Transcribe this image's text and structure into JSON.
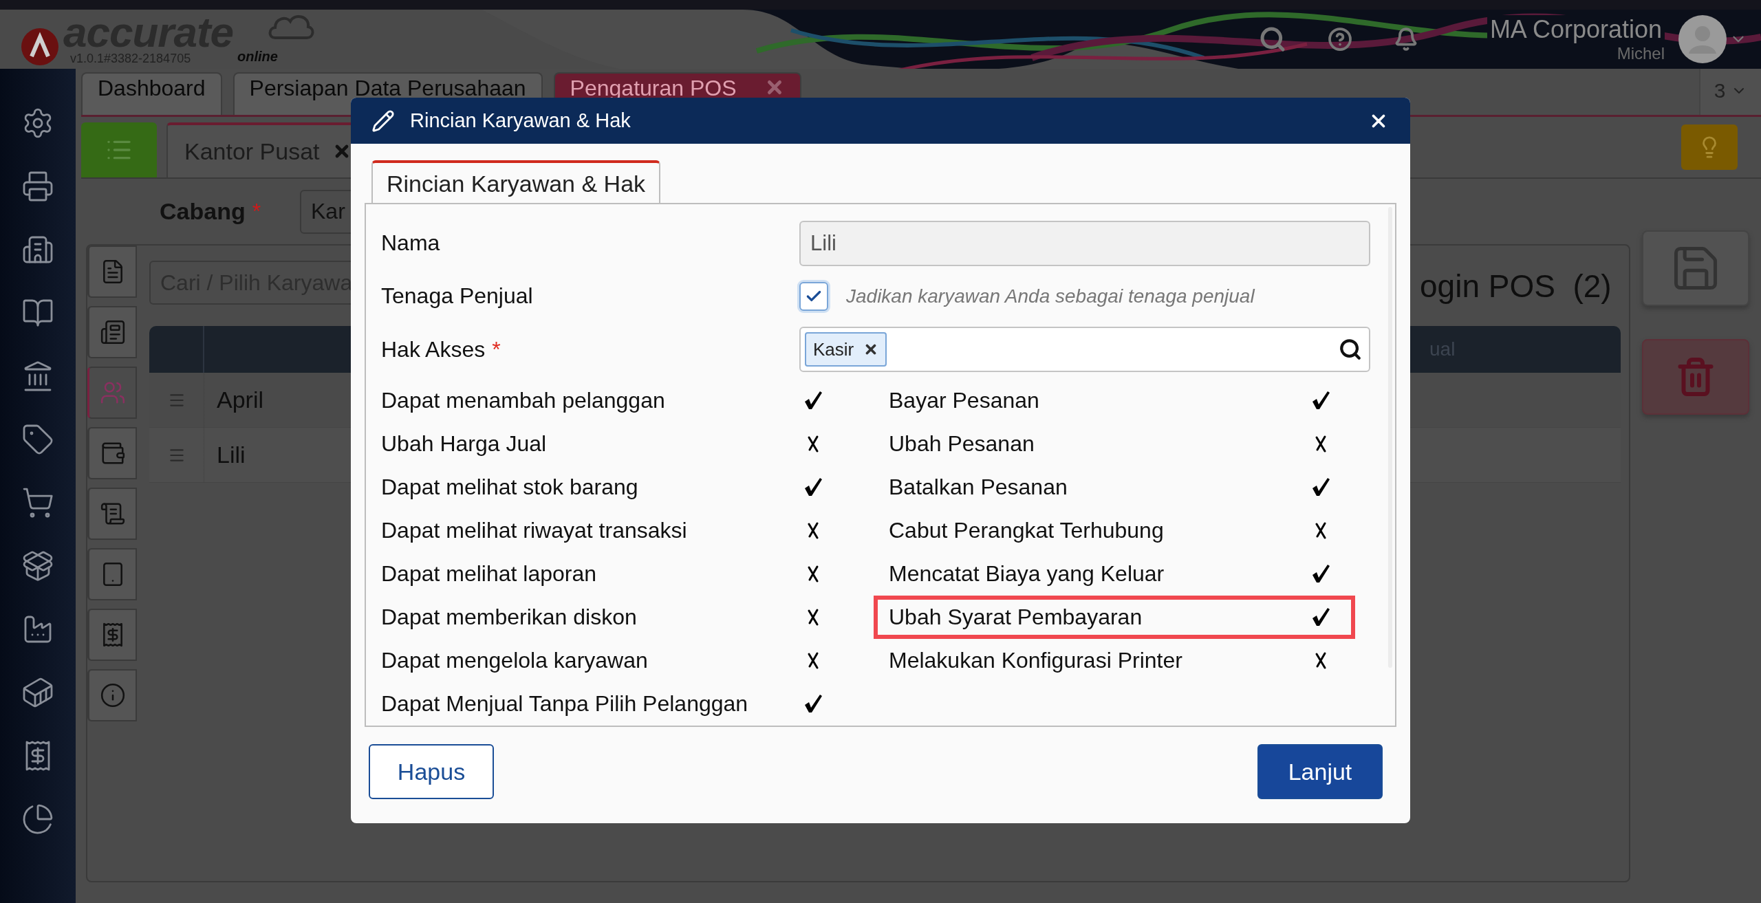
{
  "app": {
    "logo": "accurate",
    "logo_sub": "online",
    "version": "v1.0.1#3382-2184705",
    "company": "MA Corporation",
    "user": "Michel"
  },
  "tabs": [
    {
      "label": "Dashboard",
      "selected": false,
      "closable": false
    },
    {
      "label": "Persiapan Data Perusahaan",
      "selected": false,
      "closable": false
    },
    {
      "label": "Pengaturan POS",
      "selected": true,
      "closable": true
    }
  ],
  "tab_count": "3",
  "branch_tabs": [
    {
      "label": "Kantor Pusat",
      "selected": true,
      "closable": true
    }
  ],
  "branch": {
    "label": "Cabang",
    "required_mark": "*",
    "value": "Kar"
  },
  "side_tabs": [
    {
      "selected": false
    },
    {
      "selected": false
    },
    {
      "selected": true
    },
    {
      "selected": false
    },
    {
      "selected": false
    },
    {
      "selected": false
    },
    {
      "selected": false
    },
    {
      "selected": false
    }
  ],
  "employees": {
    "search_placeholder": "Cari / Pilih Karyawa",
    "rows": [
      "April",
      "Lili"
    ]
  },
  "login_pos": {
    "title": "ogin POS  (2)",
    "column": "ual"
  },
  "dialog": {
    "title": "Rincian Karyawan & Hak",
    "tabs": [
      {
        "label": "Rincian Karyawan & Hak",
        "selected": true
      }
    ],
    "fields": [
      {
        "kind": "text",
        "label": "Nama",
        "value": "Lili"
      },
      {
        "kind": "checkbox",
        "label": "Tenaga Penjual",
        "checked": true,
        "hint": "Jadikan karyawan Anda sebagai tenaga penjual"
      },
      {
        "kind": "tags",
        "label": "Hak Akses",
        "required_mark": "*",
        "tags": [
          "Kasir"
        ]
      }
    ],
    "permissions_left": [
      {
        "label": "Dapat menambah pelanggan",
        "allowed": true,
        "highlighted": false
      },
      {
        "label": "Ubah Harga Jual",
        "allowed": false,
        "highlighted": false
      },
      {
        "label": "Dapat melihat stok barang",
        "allowed": true,
        "highlighted": false
      },
      {
        "label": "Dapat melihat riwayat transaksi",
        "allowed": false,
        "highlighted": false
      },
      {
        "label": "Dapat melihat laporan",
        "allowed": false,
        "highlighted": false
      },
      {
        "label": "Dapat memberikan diskon",
        "allowed": false,
        "highlighted": false
      },
      {
        "label": "Dapat mengelola karyawan",
        "allowed": false,
        "highlighted": false
      },
      {
        "label": "Dapat Menjual Tanpa Pilih Pelanggan",
        "allowed": true,
        "highlighted": false
      }
    ],
    "permissions_right": [
      {
        "label": "Bayar Pesanan",
        "allowed": true,
        "highlighted": false
      },
      {
        "label": "Ubah Pesanan",
        "allowed": false,
        "highlighted": false
      },
      {
        "label": "Batalkan Pesanan",
        "allowed": true,
        "highlighted": false
      },
      {
        "label": "Cabut Perangkat Terhubung",
        "allowed": false,
        "highlighted": false
      },
      {
        "label": "Mencatat Biaya yang Keluar",
        "allowed": true,
        "highlighted": false
      },
      {
        "label": "Ubah Syarat Pembayaran",
        "allowed": true,
        "highlighted": true
      },
      {
        "label": "Melakukan Konfigurasi Printer",
        "allowed": false,
        "highlighted": false
      }
    ],
    "buttons": [
      {
        "label": "Hapus",
        "kind": "secondary"
      },
      {
        "label": "Lanjut",
        "kind": "primary"
      }
    ]
  }
}
